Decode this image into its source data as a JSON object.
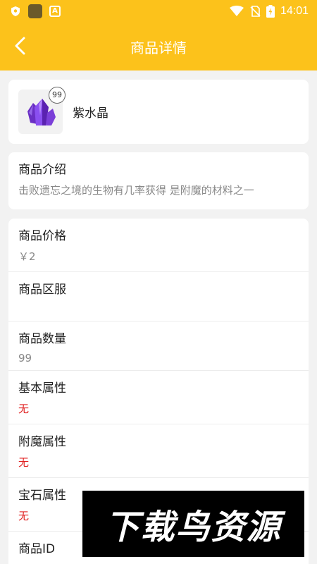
{
  "status_bar": {
    "time": "14:01"
  },
  "app_bar": {
    "title": "商品详情"
  },
  "product": {
    "name": "紫水晶",
    "badge_count": "99"
  },
  "intro": {
    "label": "商品介绍",
    "text": "击败遗忘之境的生物有几率获得 是附魔的材料之一"
  },
  "attributes": [
    {
      "label": "商品价格",
      "value": "￥2",
      "highlight": false
    },
    {
      "label": "商品区服",
      "value": "",
      "highlight": false
    },
    {
      "label": "商品数量",
      "value": "99",
      "highlight": false
    },
    {
      "label": "基本属性",
      "value": "无",
      "highlight": true
    },
    {
      "label": "附魔属性",
      "value": "无",
      "highlight": true
    },
    {
      "label": "宝石属性",
      "value": "无",
      "highlight": true
    },
    {
      "label": "商品ID",
      "value": "",
      "highlight": false
    }
  ],
  "watermark": {
    "text": "下载鸟资源"
  },
  "colors": {
    "accent": "#fcc21b",
    "highlight_value": "#e02020",
    "crystal": "#7b3fd8"
  }
}
